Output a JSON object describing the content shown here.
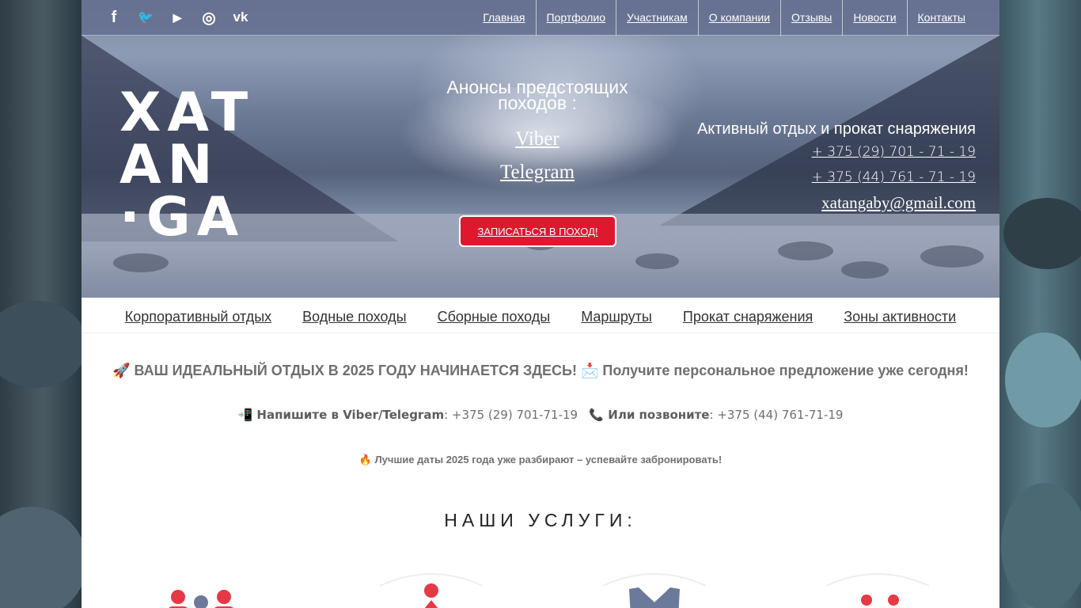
{
  "social": [
    {
      "name": "facebook-icon",
      "glyph": "f"
    },
    {
      "name": "twitter-icon",
      "glyph": "🐦"
    },
    {
      "name": "youtube-icon",
      "glyph": "▶"
    },
    {
      "name": "instagram-icon",
      "glyph": "◎"
    },
    {
      "name": "vk-icon",
      "glyph": "vk"
    }
  ],
  "topnav": [
    "Главная",
    "Портфолио",
    "Участникам",
    "О компании",
    "Отзывы",
    "Новости",
    "Контакты"
  ],
  "logo": {
    "line1": "XAT",
    "line2": "AN",
    "line3": "·GA"
  },
  "announce": {
    "title": "Анонсы предстоящих походов :",
    "viber": "Viber",
    "telegram": "Telegram",
    "cta": "ЗАПИСАТЬСЯ В ПОХОД!"
  },
  "contact": {
    "title": "Активный отдых и прокат снаряжения",
    "phone1": "+ 375 (29) 701 - 71 - 19",
    "phone2": "+ 375 (44) 761 - 71 - 19",
    "email": "xatangaby@gmail.com"
  },
  "catnav": [
    "Корпоративный отдых",
    "Водные походы",
    "Сборные походы",
    "Маршруты",
    "Прокат снаряжения",
    "Зоны активности"
  ],
  "promo": {
    "line1": "🚀 ВАШ ИДЕАЛЬНЫЙ ОТДЫХ В 2025 ГОДУ НАЧИНАЕТСЯ ЗДЕСЬ! 📩 Получите персональное предложение уже сегодня!",
    "write_label": "📲 Напишите в Viber/Telegram",
    "write_phone": ": +375 (29) 701-71-19",
    "call_label": "📞 Или позвоните",
    "call_phone": ": +375 (44) 761-71-19",
    "line3": "🔥 Лучшие даты 2025 года уже разбирают – успевайте забронировать!"
  },
  "services_title": "НАШИ УСЛУГИ:",
  "colors": {
    "accent": "#e0182d",
    "topbar": "#626c8e",
    "text": "#6f6f6f",
    "icon_red": "#e63946",
    "icon_grey": "#6b7a9a"
  }
}
